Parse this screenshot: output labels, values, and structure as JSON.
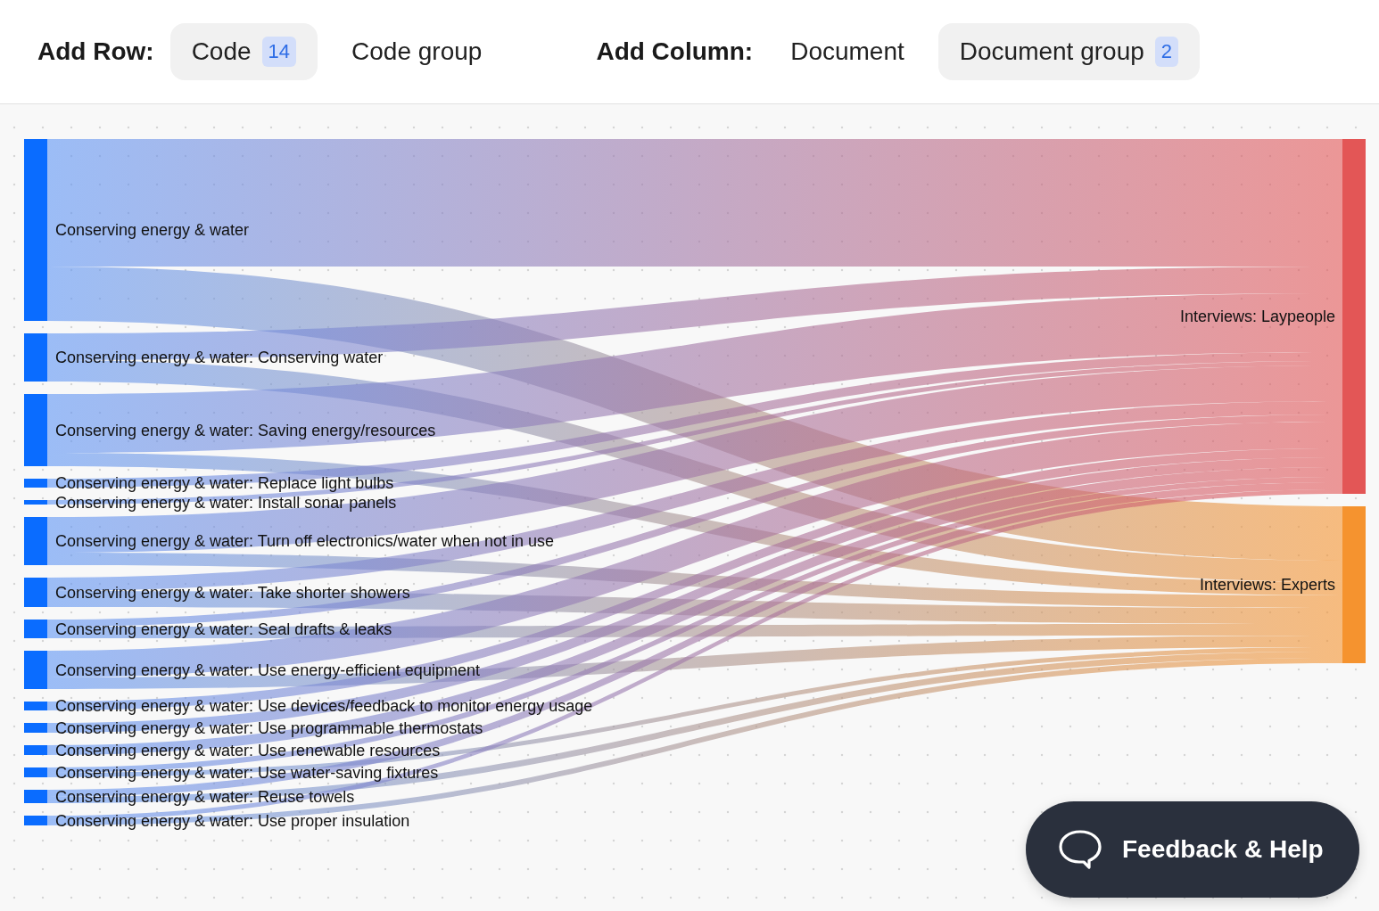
{
  "toolbar": {
    "row_label": "Add Row:",
    "row_options": [
      {
        "label": "Code",
        "badge": "14",
        "selected": true
      },
      {
        "label": "Code group",
        "selected": false
      }
    ],
    "column_label": "Add Column:",
    "column_options": [
      {
        "label": "Document",
        "selected": false
      },
      {
        "label": "Document group",
        "badge": "2",
        "selected": true
      }
    ]
  },
  "sankey": {
    "sources": [
      {
        "label": "Conserving energy & water"
      },
      {
        "label": "Conserving energy & water: Conserving water"
      },
      {
        "label": "Conserving energy & water: Saving energy/resources"
      },
      {
        "label": "Conserving energy & water: Replace light bulbs"
      },
      {
        "label": "Conserving energy & water: Install sonar panels"
      },
      {
        "label": "Conserving energy & water: Turn off electronics/water when not in use"
      },
      {
        "label": "Conserving energy & water: Take shorter showers"
      },
      {
        "label": "Conserving energy & water: Seal drafts & leaks"
      },
      {
        "label": "Conserving energy & water: Use energy-efficient equipment"
      },
      {
        "label": "Conserving energy & water: Use devices/feedback to monitor energy usage"
      },
      {
        "label": "Conserving energy & water: Use programmable thermostats"
      },
      {
        "label": "Conserving energy & water: Use renewable resources"
      },
      {
        "label": "Conserving energy & water: Use water-saving fixtures"
      },
      {
        "label": "Conserving energy & water: Reuse towels"
      },
      {
        "label": "Conserving energy & water: Use proper insulation"
      }
    ],
    "targets": [
      {
        "label": "Interviews: Laypeople",
        "color": "#e35656"
      },
      {
        "label": "Interviews: Experts",
        "color": "#f5932f"
      }
    ]
  },
  "feedback_button": {
    "label": "Feedback & Help"
  }
}
